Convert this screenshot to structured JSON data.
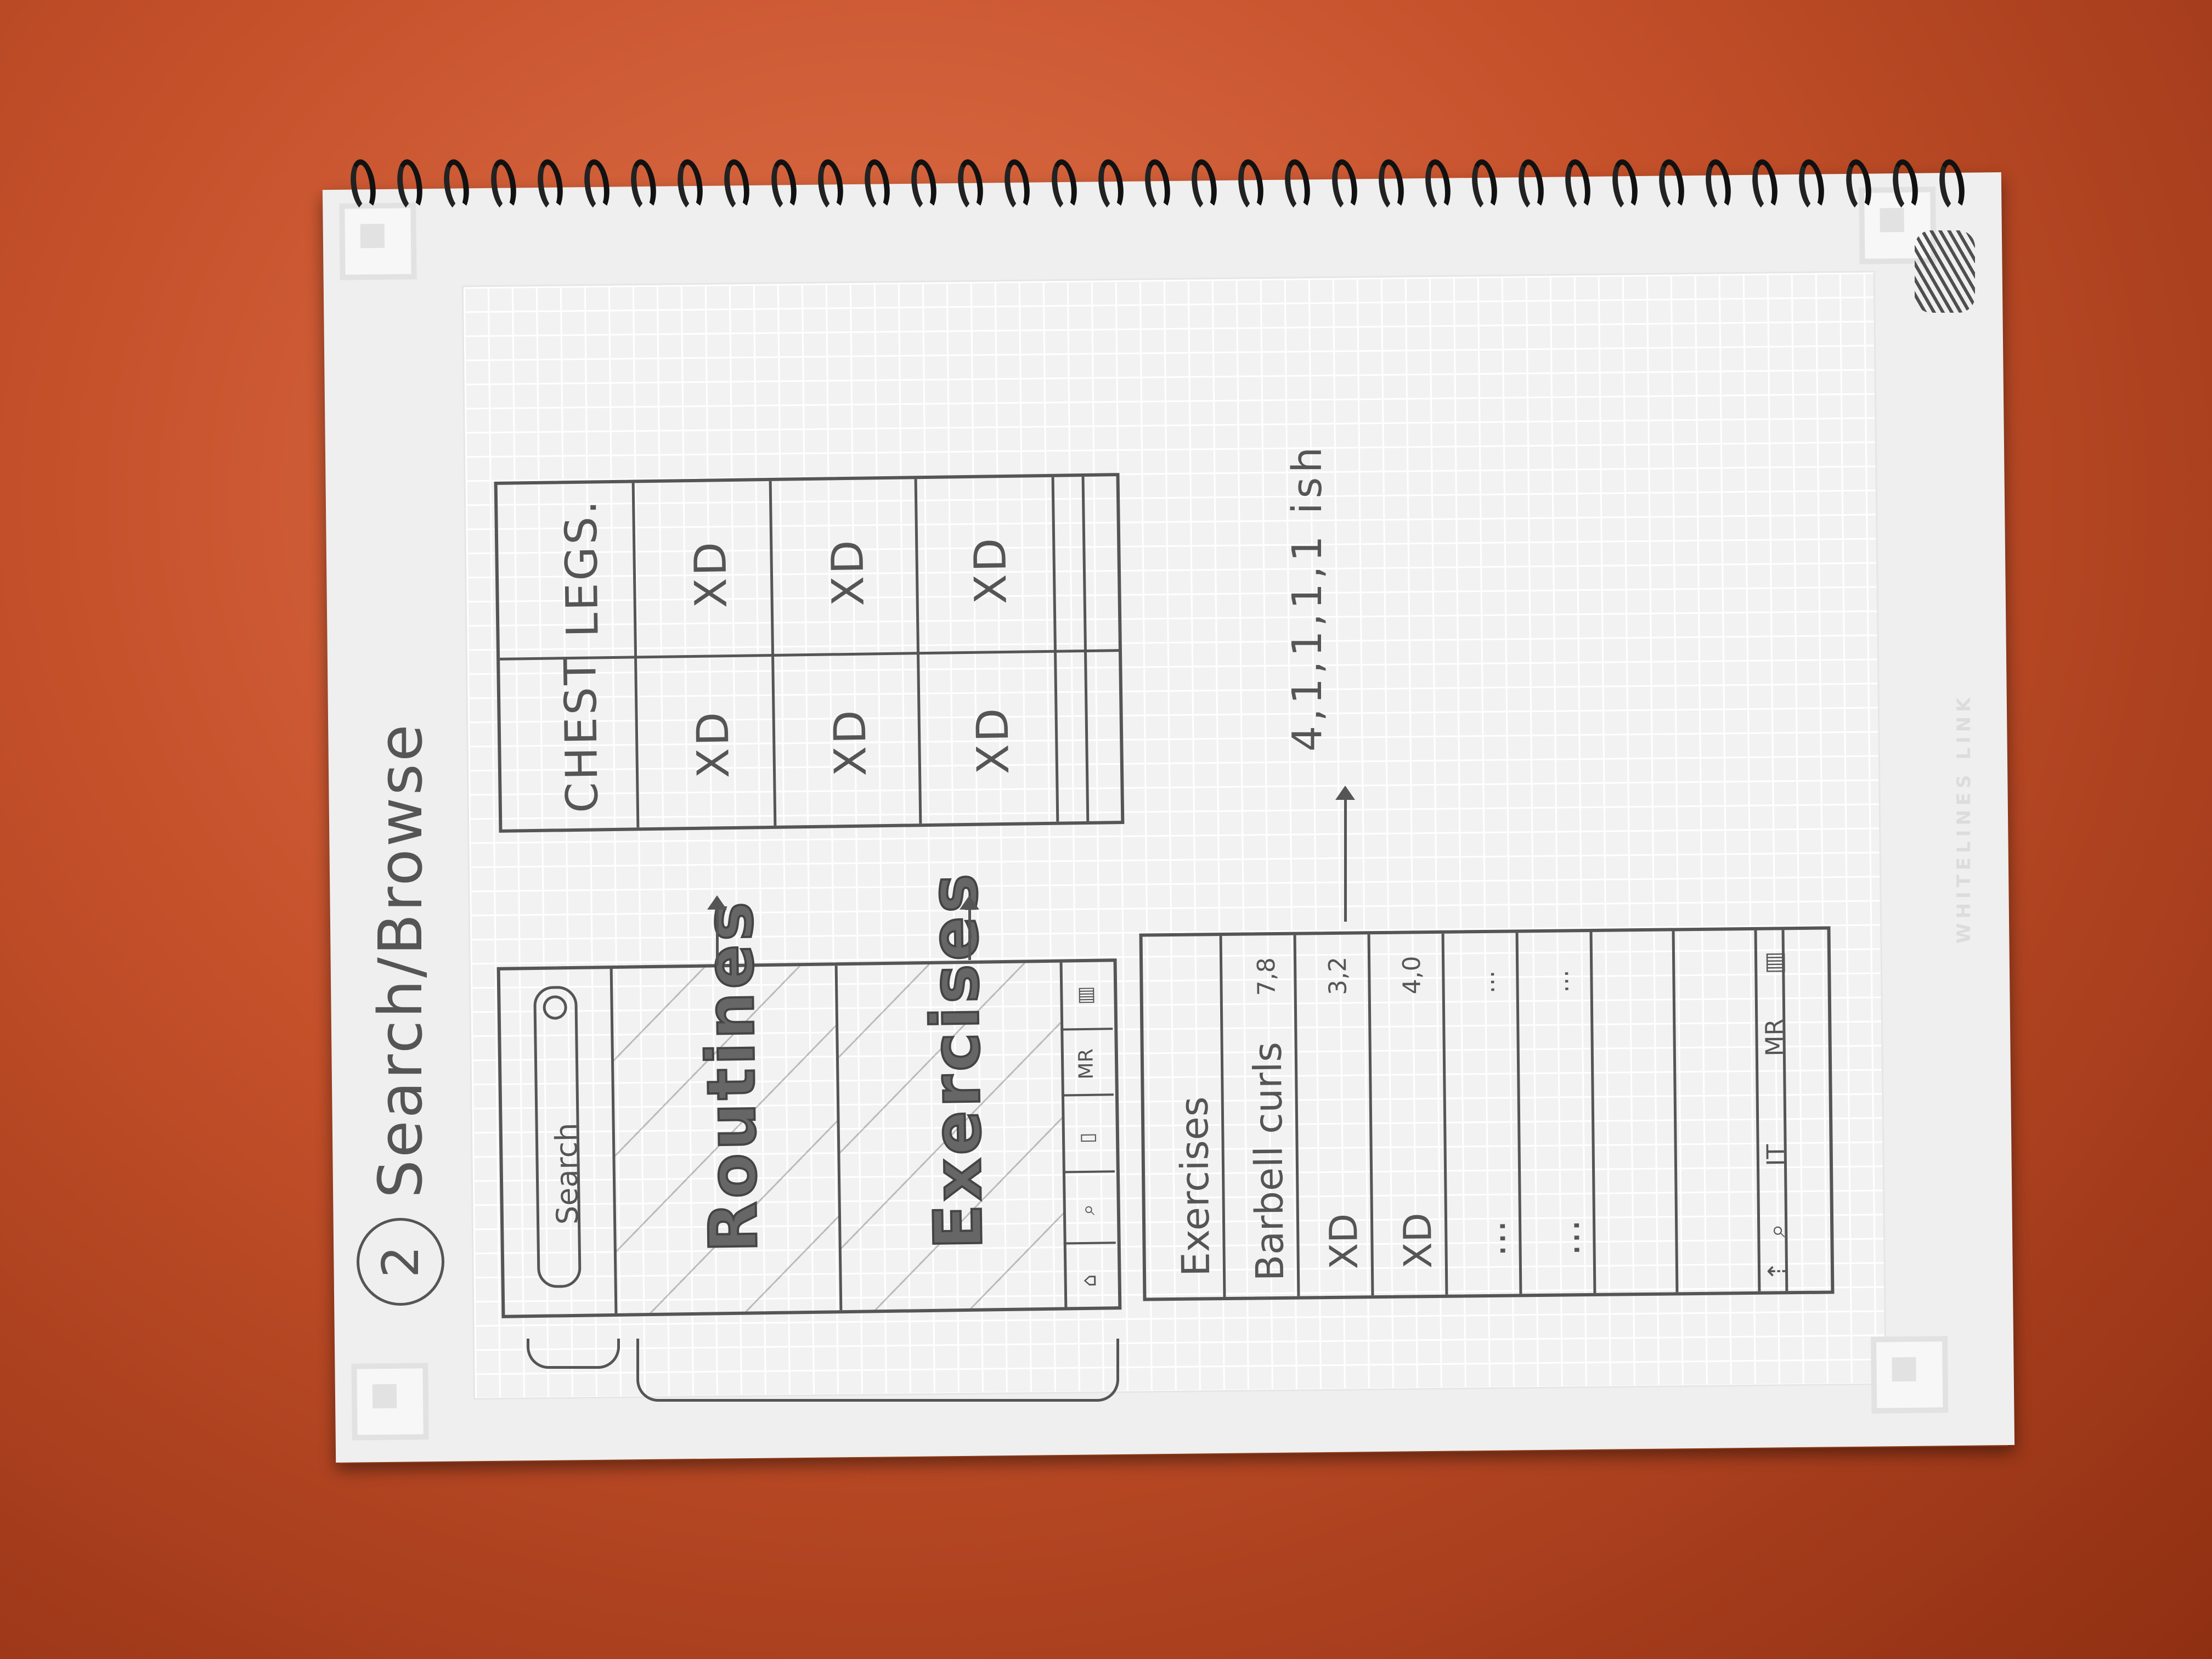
{
  "sketch": {
    "step_number": "2",
    "title": "Search/Browse",
    "browse_screen": {
      "search_placeholder": "Search",
      "panels": [
        "Routines",
        "Exercises"
      ],
      "nav": [
        "MR"
      ]
    },
    "category_screen": {
      "columns": [
        "CHEST",
        "LEGS."
      ],
      "cells": [
        "XD",
        "XD",
        "XD",
        "XD",
        "XD",
        "XD"
      ]
    },
    "exercise_list": {
      "header": "Exercises",
      "rows": [
        {
          "name": "Barbell curls",
          "value": "7,8"
        },
        {
          "name": "XD",
          "value": "3,2"
        },
        {
          "name": "XD",
          "value": "4,0"
        },
        {
          "name": "...",
          "value": "..."
        },
        {
          "name": "...",
          "value": "..."
        }
      ],
      "nav": [
        "IT",
        "MR"
      ]
    },
    "note": "4,1,1,1,1 ish",
    "watermark": "WHITELINES LINK"
  }
}
